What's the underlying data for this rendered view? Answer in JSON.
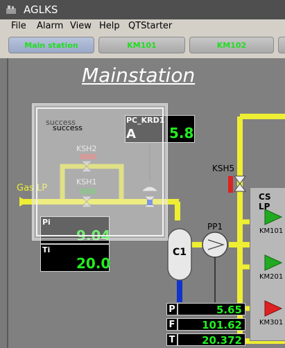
{
  "window": {
    "title": "AGLKS"
  },
  "menu": [
    "File",
    "Alarm",
    "View",
    "Help",
    "QTStarter"
  ],
  "tabs": [
    {
      "label": "Main station",
      "active": true
    },
    {
      "label": "KM101",
      "active": false
    },
    {
      "label": "KM102",
      "active": false
    }
  ],
  "page_title": "Mainstation",
  "overlay": {
    "status_shadow": "success",
    "status": "success"
  },
  "pc": {
    "name": "PC_KRD1",
    "mode": "A",
    "value": "5.8"
  },
  "valves": {
    "ksh2": "KSH2",
    "ksh1": "KSH1",
    "ksh5": "KSH5"
  },
  "gas_inlet": "Gas LP",
  "pi": {
    "label": "Pi",
    "value": "9.04"
  },
  "ti": {
    "label": "Ti",
    "value": "20.0"
  },
  "c1": "C1",
  "pp1": "PP1",
  "cs_label": "CS LP",
  "compressors": [
    {
      "label": "KM101",
      "status_color": "#22aa22"
    },
    {
      "label": "KM201",
      "status_color": "#22aa22"
    },
    {
      "label": "KM301",
      "status_color": "#dd2222"
    }
  ],
  "readouts": [
    {
      "label": "P",
      "value": "5.65"
    },
    {
      "label": "F",
      "value": "101.62"
    },
    {
      "label": "T",
      "value": "20.372"
    }
  ],
  "colors": {
    "pipe": "#eeee33",
    "alarm_red": "#dd2222",
    "value_green": "#22ee22",
    "water_blue": "#1133cc"
  }
}
